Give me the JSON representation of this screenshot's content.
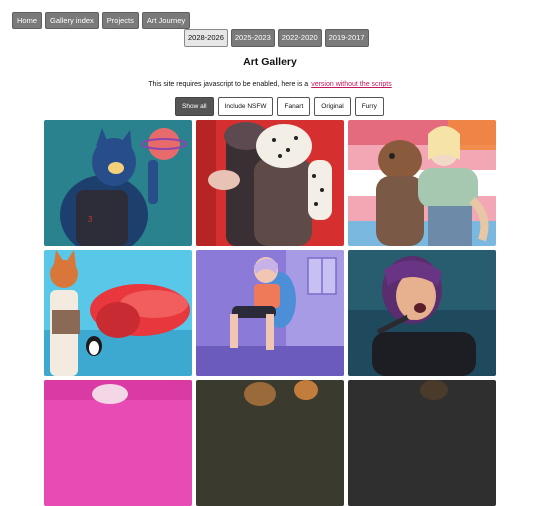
{
  "topnav": {
    "items": [
      {
        "label": "Home"
      },
      {
        "label": "Gallery index"
      },
      {
        "label": "Projects"
      },
      {
        "label": "Art Journey"
      }
    ]
  },
  "year_tabs": {
    "selected": "2028-2026",
    "items": [
      {
        "label": "2028-2026"
      },
      {
        "label": "2025-2023"
      },
      {
        "label": "2022-2020"
      },
      {
        "label": "2019-2017"
      }
    ]
  },
  "page": {
    "title": "Art Gallery",
    "notice_text": "This site requires javascript to be enabled, here is a",
    "notice_link": "version without the scripts"
  },
  "filters": {
    "selected": "Show all",
    "items": [
      {
        "label": "Show all"
      },
      {
        "label": "Include NSFW"
      },
      {
        "label": "Fanart"
      },
      {
        "label": "Original"
      },
      {
        "label": "Furry"
      }
    ]
  },
  "colors": {
    "nav_bg": "#7a7a7a",
    "active_filter_bg": "#555555",
    "link": "#c2185b"
  }
}
